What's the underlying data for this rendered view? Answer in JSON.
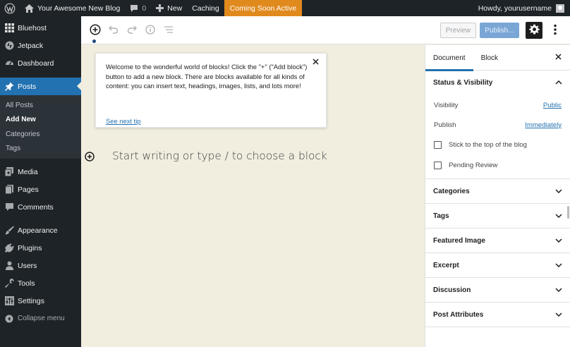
{
  "adminbar": {
    "site_name": "Your Awesome New Blog",
    "comments_count": "0",
    "new_label": "New",
    "caching_label": "Caching",
    "coming_soon_label": "Coming Soon Active",
    "howdy": "Howdy, yourusername",
    "colors": {
      "bar": "#1d2327",
      "coming_soon": "#e08a1e"
    }
  },
  "sidebar": {
    "items_top": [
      {
        "label": "Bluehost",
        "icon": "bluehost-grid-icon"
      },
      {
        "label": "Jetpack",
        "icon": "jetpack-icon"
      },
      {
        "label": "Dashboard",
        "icon": "dashboard-gauge-icon"
      }
    ],
    "posts": {
      "label": "Posts",
      "icon": "pushpin-icon"
    },
    "posts_submenu": [
      {
        "label": "All Posts"
      },
      {
        "label": "Add New"
      },
      {
        "label": "Categories"
      },
      {
        "label": "Tags"
      }
    ],
    "items_mid": [
      {
        "label": "Media",
        "icon": "media-icon"
      },
      {
        "label": "Pages",
        "icon": "pages-icon"
      },
      {
        "label": "Comments",
        "icon": "comment-bubble-icon"
      }
    ],
    "items_bottom": [
      {
        "label": "Appearance",
        "icon": "paintbrush-icon"
      },
      {
        "label": "Plugins",
        "icon": "plug-icon"
      },
      {
        "label": "Users",
        "icon": "user-icon"
      },
      {
        "label": "Tools",
        "icon": "wrench-icon"
      },
      {
        "label": "Settings",
        "icon": "sliders-icon"
      }
    ],
    "collapse_label": "Collapse menu",
    "colors": {
      "active": "#2271b1"
    }
  },
  "toolbar": {
    "preview_label": "Preview",
    "publish_label": "Publish..."
  },
  "canvas": {
    "tip_text": "Welcome to the wonderful world of blocks! Click the \"+\" (\"Add block\") button to add a new block. There are blocks available for all kinds of content: you can insert text, headings, images, lists, and lots more!",
    "tip_link": "See next tip",
    "placeholder": "Start writing or type / to choose a block"
  },
  "settings": {
    "tab_document": "Document",
    "tab_block": "Block",
    "status_panel": {
      "title": "Status & Visibility",
      "visibility_label": "Visibility",
      "visibility_value": "Public",
      "publish_label": "Publish",
      "publish_value": "Immediately",
      "stick_label": "Stick to the top of the blog",
      "pending_label": "Pending Review"
    },
    "panels": [
      {
        "title": "Categories"
      },
      {
        "title": "Tags"
      },
      {
        "title": "Featured Image"
      },
      {
        "title": "Excerpt"
      },
      {
        "title": "Discussion"
      },
      {
        "title": "Post Attributes"
      }
    ]
  }
}
